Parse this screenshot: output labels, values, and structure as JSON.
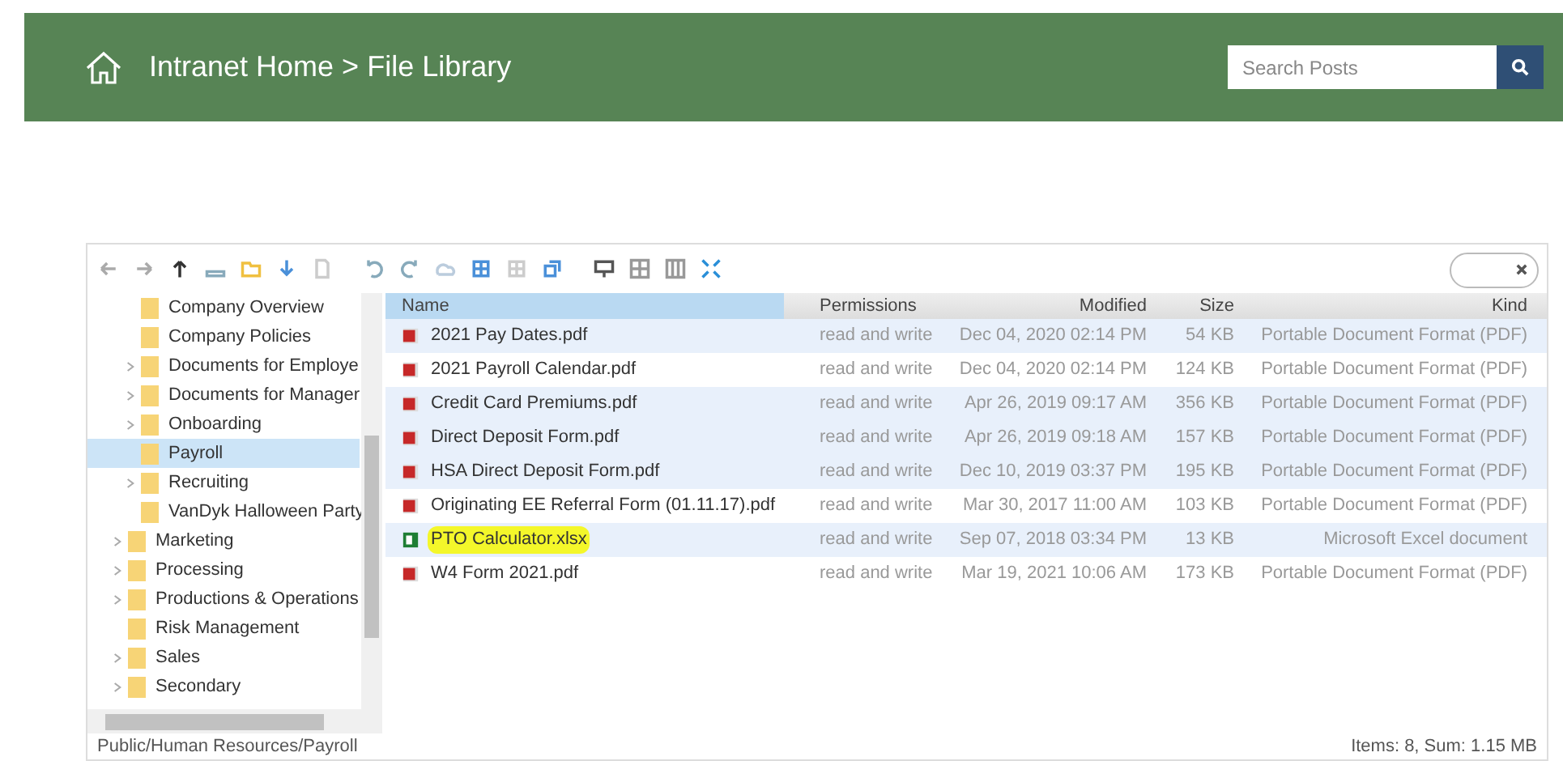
{
  "header": {
    "breadcrumb": "Intranet Home > File Library",
    "search": {
      "placeholder": "Search Posts"
    }
  },
  "tree": {
    "subfolders": [
      {
        "label": "Company Overview",
        "has_children": false,
        "selected": false
      },
      {
        "label": "Company Policies",
        "has_children": false,
        "selected": false
      },
      {
        "label": "Documents for Employe",
        "has_children": true,
        "selected": false
      },
      {
        "label": "Documents for Manager",
        "has_children": true,
        "selected": false
      },
      {
        "label": "Onboarding",
        "has_children": true,
        "selected": false
      },
      {
        "label": "Payroll",
        "has_children": false,
        "selected": true
      },
      {
        "label": "Recruiting",
        "has_children": true,
        "selected": false
      },
      {
        "label": "VanDyk Halloween Party",
        "has_children": false,
        "selected": false
      }
    ],
    "folders": [
      {
        "label": "Marketing",
        "has_children": true,
        "selected": false
      },
      {
        "label": "Processing",
        "has_children": true,
        "selected": false
      },
      {
        "label": "Productions & Operations",
        "has_children": true,
        "selected": false
      },
      {
        "label": "Risk Management",
        "has_children": false,
        "selected": false
      },
      {
        "label": "Sales",
        "has_children": true,
        "selected": false
      },
      {
        "label": "Secondary",
        "has_children": true,
        "selected": false
      }
    ]
  },
  "table": {
    "columns": [
      "Name",
      "Permissions",
      "Modified",
      "Size",
      "Kind"
    ],
    "rows": [
      {
        "kind": "pdf",
        "name": "2021 Pay Dates.pdf",
        "permissions": "read and write",
        "modified": "Dec 04, 2020 02:14 PM",
        "size": "54 KB",
        "type": "Portable Document Format (PDF)",
        "selected": true,
        "highlighted": false
      },
      {
        "kind": "pdf",
        "name": "2021 Payroll Calendar.pdf",
        "permissions": "read and write",
        "modified": "Dec 04, 2020 02:14 PM",
        "size": "124 KB",
        "type": "Portable Document Format (PDF)",
        "selected": false,
        "highlighted": false
      },
      {
        "kind": "pdf",
        "name": "Credit Card Premiums.pdf",
        "permissions": "read and write",
        "modified": "Apr 26, 2019 09:17 AM",
        "size": "356 KB",
        "type": "Portable Document Format (PDF)",
        "selected": true,
        "highlighted": false
      },
      {
        "kind": "pdf",
        "name": "Direct Deposit Form.pdf",
        "permissions": "read and write",
        "modified": "Apr 26, 2019 09:18 AM",
        "size": "157 KB",
        "type": "Portable Document Format (PDF)",
        "selected": true,
        "highlighted": false
      },
      {
        "kind": "pdf",
        "name": "HSA Direct Deposit Form.pdf",
        "permissions": "read and write",
        "modified": "Dec 10, 2019 03:37 PM",
        "size": "195 KB",
        "type": "Portable Document Format (PDF)",
        "selected": true,
        "highlighted": false
      },
      {
        "kind": "pdf",
        "name": "Originating EE Referral Form (01.11.17).pdf",
        "permissions": "read and write",
        "modified": "Mar 30, 2017 11:00 AM",
        "size": "103 KB",
        "type": "Portable Document Format (PDF)",
        "selected": false,
        "highlighted": false
      },
      {
        "kind": "xlsx",
        "name": "PTO Calculator.xlsx",
        "permissions": "read and write",
        "modified": "Sep 07, 2018 03:34 PM",
        "size": "13 KB",
        "type": "Microsoft Excel document",
        "selected": true,
        "highlighted": true
      },
      {
        "kind": "pdf",
        "name": "W4 Form 2021.pdf",
        "permissions": "read and write",
        "modified": "Mar 19, 2021 10:06 AM",
        "size": "173 KB",
        "type": "Portable Document Format (PDF)",
        "selected": false,
        "highlighted": false
      }
    ]
  },
  "status_bar": {
    "path": "Public/Human Resources/Payroll",
    "summary": "Items: 8, Sum: 1.15 MB"
  }
}
